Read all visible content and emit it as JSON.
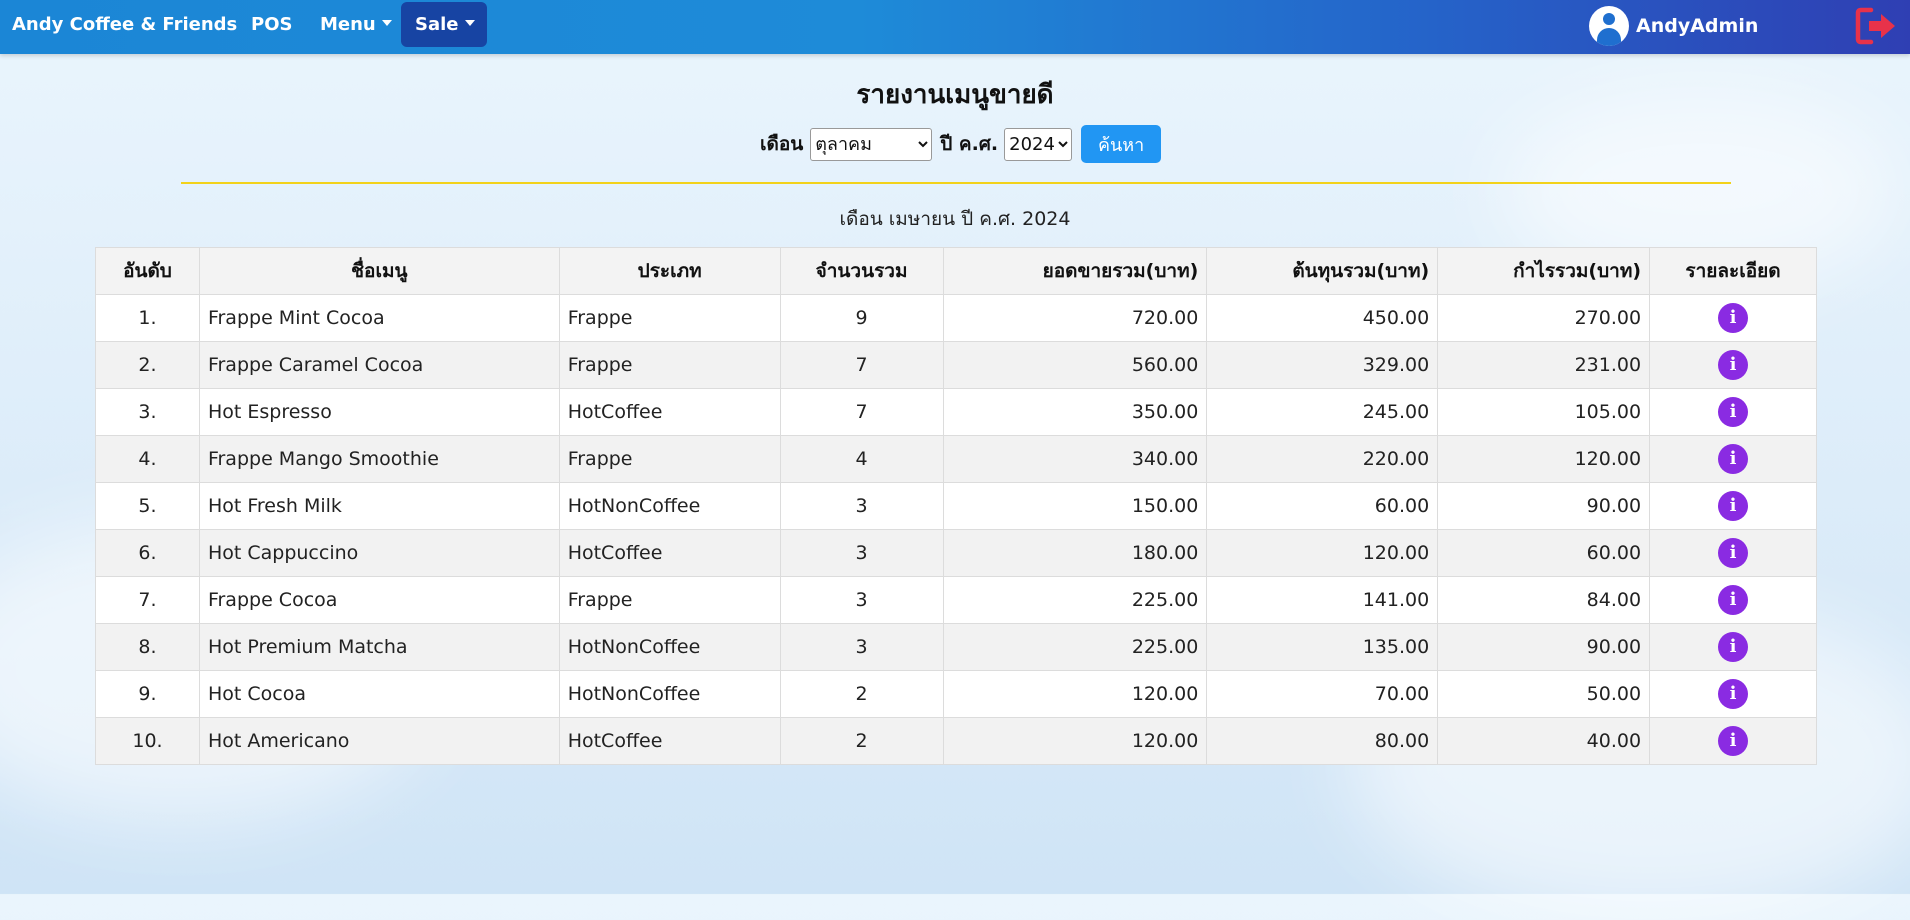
{
  "navbar": {
    "brand": "Andy Coffee & Friends",
    "pos": "POS",
    "menu": "Menu",
    "sale": "Sale",
    "user": "AndyAdmin"
  },
  "page": {
    "title": "รายงานเมนูขายดี",
    "month_label": "เดือน",
    "month_value": "ตุลาคม",
    "year_label": "ปี ค.ศ.",
    "year_value": "2024",
    "search_button": "ค้นหา",
    "subtitle": "เดือน เมษายน ปี ค.ศ. 2024"
  },
  "colors": {
    "accent": "#2196f3",
    "info": "#8a2be2",
    "divider": "#f2d21a",
    "logout": "#e8324a"
  },
  "table": {
    "headers": [
      "อันดับ",
      "ชื่อเมนู",
      "ประเภท",
      "จำนวนรวม",
      "ยอดขายรวม(บาท)",
      "ต้นทุนรวม(บาท)",
      "กำไรรวม(บาท)",
      "รายละเอียด"
    ],
    "rows": [
      [
        "1.",
        "Frappe Mint Cocoa",
        "Frappe",
        "9",
        "720.00",
        "450.00",
        "270.00"
      ],
      [
        "2.",
        "Frappe Caramel Cocoa",
        "Frappe",
        "7",
        "560.00",
        "329.00",
        "231.00"
      ],
      [
        "3.",
        "Hot Espresso",
        "HotCoffee",
        "7",
        "350.00",
        "245.00",
        "105.00"
      ],
      [
        "4.",
        "Frappe Mango Smoothie",
        "Frappe",
        "4",
        "340.00",
        "220.00",
        "120.00"
      ],
      [
        "5.",
        "Hot Fresh Milk",
        "HotNonCoffee",
        "3",
        "150.00",
        "60.00",
        "90.00"
      ],
      [
        "6.",
        "Hot Cappuccino",
        "HotCoffee",
        "3",
        "180.00",
        "120.00",
        "60.00"
      ],
      [
        "7.",
        "Frappe Cocoa",
        "Frappe",
        "3",
        "225.00",
        "141.00",
        "84.00"
      ],
      [
        "8.",
        "Hot Premium Matcha",
        "HotNonCoffee",
        "3",
        "225.00",
        "135.00",
        "90.00"
      ],
      [
        "9.",
        "Hot Cocoa",
        "HotNonCoffee",
        "2",
        "120.00",
        "70.00",
        "50.00"
      ],
      [
        "10.",
        "Hot Americano",
        "HotCoffee",
        "2",
        "120.00",
        "80.00",
        "40.00"
      ]
    ],
    "detail_icon": "info-icon"
  }
}
